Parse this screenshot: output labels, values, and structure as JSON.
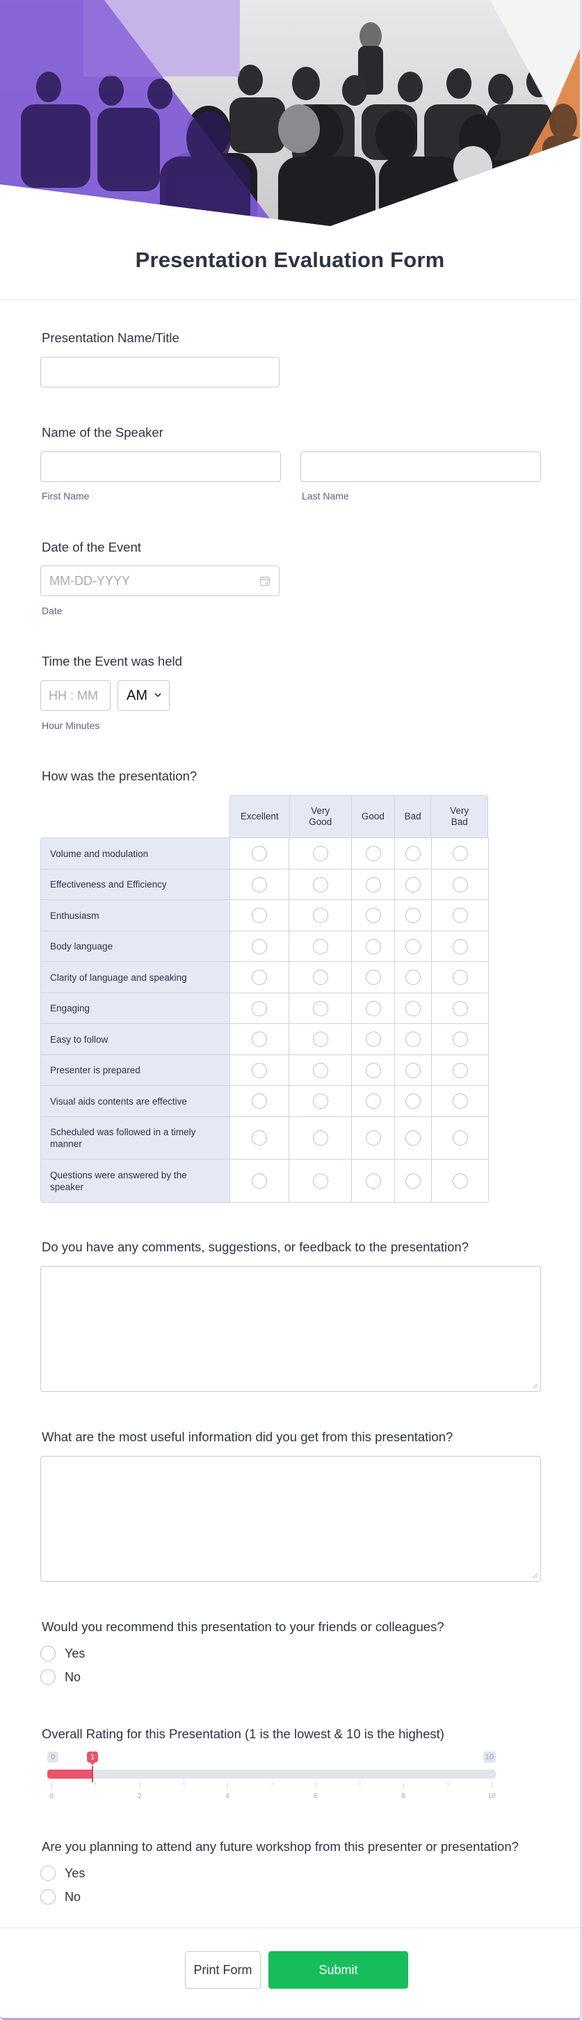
{
  "header": {
    "title": "Presentation Evaluation Form",
    "image_alt": "Audience attending a presentation",
    "colors": {
      "purple": "#7f5ad6",
      "orange": "#e0864a"
    }
  },
  "fields": {
    "presentation_name": {
      "label": "Presentation Name/Title",
      "value": ""
    },
    "speaker": {
      "label": "Name of the Speaker",
      "first_value": "",
      "first_sublabel": "First Name",
      "last_value": "",
      "last_sublabel": "Last Name"
    },
    "date": {
      "label": "Date of the Event",
      "placeholder": "MM-DD-YYYY",
      "sublabel": "Date",
      "icon": "calendar-icon"
    },
    "time": {
      "label": "Time the Event was held",
      "placeholder": "HH : MM",
      "ampm_selected": "AM",
      "sublabel": "Hour Minutes",
      "icon": "chevron-down-icon"
    }
  },
  "matrix": {
    "label": "How was the presentation?",
    "columns": [
      "Excellent",
      "Very\nGood",
      "Good",
      "Bad",
      "Very\nBad"
    ],
    "rows": [
      "Volume and modulation",
      "Effectiveness and Efficiency",
      "Enthusiasm",
      "Body language",
      "Clarity of language and speaking",
      "Engaging",
      "Easy to follow",
      "Presenter is prepared",
      "Visual aids contents are effective",
      "Scheduled was followed in a timely manner",
      "Questions were answered by the speaker"
    ]
  },
  "comments": {
    "label": "Do you have any comments, suggestions, or feedback to the presentation?",
    "value": ""
  },
  "useful_info": {
    "label": "What are the most useful information did you get from this presentation?",
    "value": ""
  },
  "recommend": {
    "label": "Would you recommend this presentation to your friends or colleagues?",
    "options": [
      "Yes",
      "No"
    ],
    "selected": null
  },
  "rating": {
    "label": "Overall Rating for this Presentation (1 is the lowest & 10 is the highest)",
    "min": 0,
    "max": 10,
    "value": 1,
    "min_label": "0",
    "max_label": "10",
    "value_label": "1",
    "tick_labels": [
      "0",
      "2",
      "4",
      "6",
      "8",
      "10"
    ],
    "accent": "#ea5369"
  },
  "future_workshop": {
    "label": "Are you planning to attend any future workshop from this presenter or presentation?",
    "options": [
      "Yes",
      "No"
    ],
    "selected": null
  },
  "buttons": {
    "print": "Print Form",
    "submit": "Submit",
    "submit_color": "#18bd5b"
  }
}
